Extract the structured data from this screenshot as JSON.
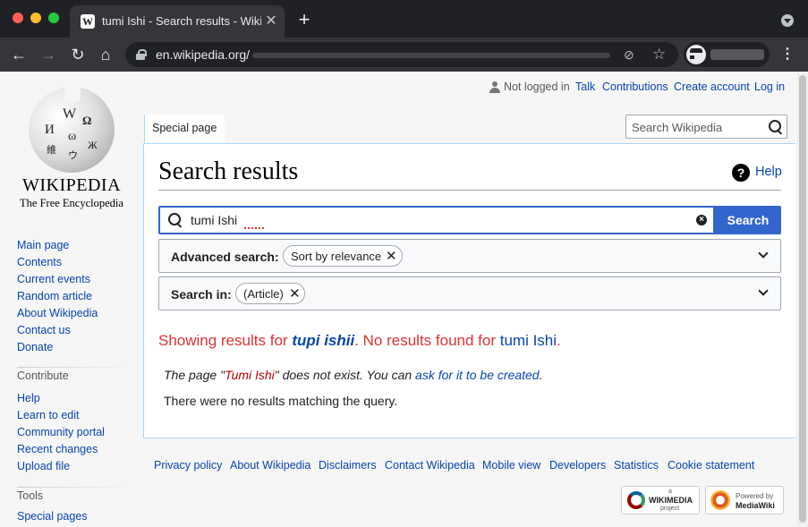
{
  "browser": {
    "tab_title": "tumi Ishi - Search results - Wikipedia",
    "tab_favicon": "W",
    "tab_close": "✕",
    "new_tab": "+",
    "url": "en.wikipedia.org/"
  },
  "wiki": {
    "logo": {
      "wordmark": "WIKIPEDIA",
      "tagline": "The Free Encyclopedia",
      "glyphs": [
        "W",
        "Ω",
        "И",
        "ω",
        "維",
        "ウ",
        "Ж"
      ]
    },
    "nav_links": [
      "Main page",
      "Contents",
      "Current events",
      "Random article",
      "About Wikipedia",
      "Contact us",
      "Donate"
    ],
    "contribute": {
      "heading": "Contribute",
      "links": [
        "Help",
        "Learn to edit",
        "Community portal",
        "Recent changes",
        "Upload file"
      ]
    },
    "tools": {
      "heading": "Tools",
      "links": [
        "Special pages"
      ]
    },
    "personal": {
      "not_logged_in": "Not logged in",
      "talk": "Talk",
      "contributions": "Contributions",
      "create_account": "Create account",
      "log_in": "Log in"
    },
    "tab_special": "Special page",
    "search_placeholder": "Search Wikipedia",
    "page_title": "Search results",
    "help_label": "Help",
    "help_icon": "?",
    "query": "tumi Ishi",
    "search_button": "Search",
    "advanced": {
      "label": "Advanced search:",
      "chip": "Sort by relevance"
    },
    "search_in": {
      "label": "Search in:",
      "chip": "(Article)"
    },
    "chip_close": "✕",
    "showing": {
      "prefix": "Showing results for",
      "suggestion": "tupi ishii",
      "middle": ". No results found for",
      "original": "tumi Ishi",
      "suffix": "."
    },
    "not_exist": {
      "prefix": "The page \"",
      "page": "Tumi Ishi",
      "middle": "\" does not exist. You can",
      "link": "ask for it to be created",
      "suffix": "."
    },
    "no_match": "There were no results matching the query.",
    "footer_links": [
      "Privacy policy",
      "About Wikipedia",
      "Disclaimers",
      "Contact Wikipedia",
      "Mobile view",
      "Developers",
      "Statistics",
      "Cookie statement"
    ],
    "badges": {
      "wikimedia": {
        "small": "a",
        "big": "WIKIMEDIA",
        "sub": "project"
      },
      "mediawiki": {
        "small": "Powered by",
        "big": "MediaWiki"
      }
    }
  }
}
